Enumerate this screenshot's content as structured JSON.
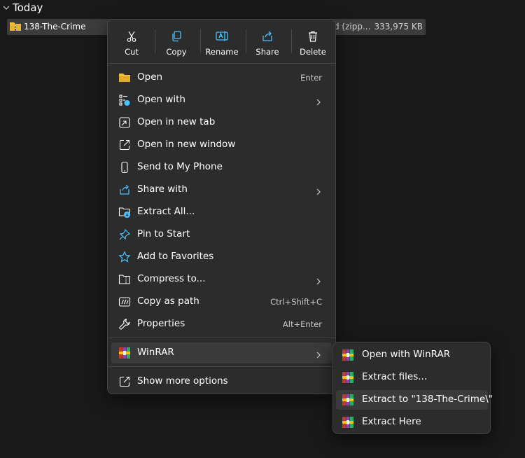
{
  "group": {
    "label": "Today"
  },
  "file": {
    "name": "138-The-Crime",
    "type": "d (zipp...",
    "size": "333,975 KB"
  },
  "quick_actions": [
    {
      "label": "Cut",
      "icon": "scissors-icon"
    },
    {
      "label": "Copy",
      "icon": "copy-icon"
    },
    {
      "label": "Rename",
      "icon": "rename-icon"
    },
    {
      "label": "Share",
      "icon": "share-icon"
    },
    {
      "label": "Delete",
      "icon": "trash-icon"
    }
  ],
  "menu_items": [
    {
      "label": "Open",
      "shortcut": "Enter",
      "icon": "folder-open-icon"
    },
    {
      "label": "Open with",
      "icon": "open-with-icon",
      "submenu": true
    },
    {
      "label": "Open in new tab",
      "icon": "new-tab-icon"
    },
    {
      "label": "Open in new window",
      "icon": "new-window-icon"
    },
    {
      "label": "Send to My Phone",
      "icon": "phone-icon"
    },
    {
      "label": "Share with",
      "icon": "share-with-icon",
      "submenu": true
    },
    {
      "label": "Extract All...",
      "icon": "extract-all-icon"
    },
    {
      "label": "Pin to Start",
      "icon": "pin-icon"
    },
    {
      "label": "Add to Favorites",
      "icon": "star-icon"
    },
    {
      "label": "Compress to...",
      "icon": "compress-icon",
      "submenu": true
    },
    {
      "label": "Copy as path",
      "shortcut": "Ctrl+Shift+C",
      "icon": "copy-path-icon"
    },
    {
      "label": "Properties",
      "shortcut": "Alt+Enter",
      "icon": "wrench-icon"
    },
    {
      "label": "WinRAR",
      "icon": "winrar-icon",
      "submenu": true
    },
    {
      "label": "Show more options",
      "icon": "more-options-icon"
    }
  ],
  "winrar_submenu": [
    {
      "label": "Open with WinRAR",
      "icon": "winrar-icon"
    },
    {
      "label": "Extract files...",
      "icon": "winrar-icon"
    },
    {
      "label": "Extract to \"138-The-Crime\\\"",
      "icon": "winrar-icon"
    },
    {
      "label": "Extract Here",
      "icon": "winrar-icon"
    }
  ],
  "colors": {
    "background": "#191919",
    "menu_bg": "#2c2c2c",
    "accent_blue": "#4cc2ff",
    "folder_yellow": "#f4c542"
  }
}
